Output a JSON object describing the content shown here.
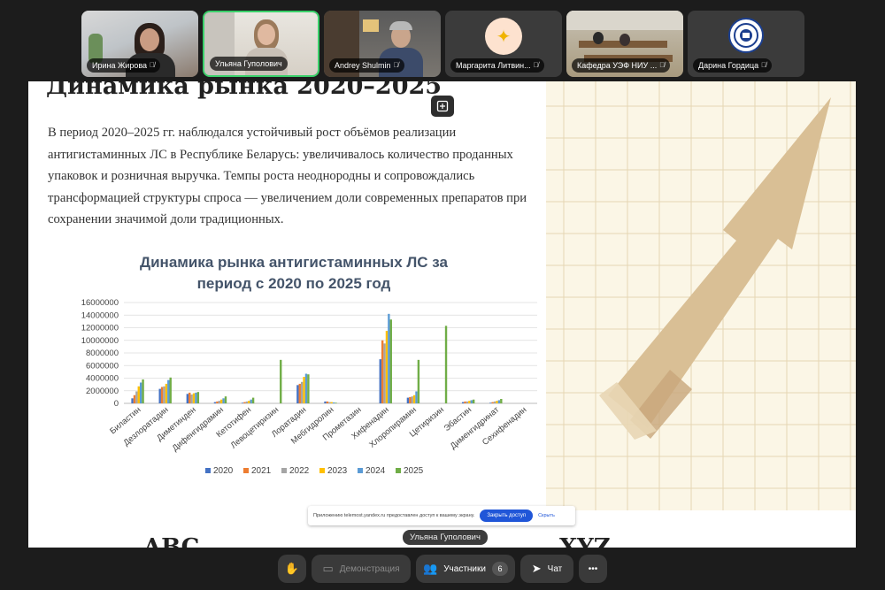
{
  "participants": [
    {
      "name": "Ирина Жирова",
      "muted": true
    },
    {
      "name": "Ульяна Гуполович",
      "muted": false,
      "active": true
    },
    {
      "name": "Andrey Shulmin",
      "muted": true
    },
    {
      "name": "Маргарита Литвин...",
      "muted": true
    },
    {
      "name": "Кафедра УЭФ НИУ ...",
      "muted": true
    },
    {
      "name": "Дарина Гордица",
      "muted": true
    }
  ],
  "slide": {
    "title": "Динамика рынка 2020–2025",
    "paragraph": "В период 2020–2025 гг. наблюдался устойчивый рост объёмов реализации антигистаминных ЛС в Республике Беларусь: увеличивалось количество проданных упаковок и розничная выручка. Темпы роста неоднородны и сопровождались трансформацией структуры спроса — увеличением доли современных препаратов при сохранении значимой доли традиционных.",
    "bottom_left": "ABC",
    "bottom_right": "XYZ"
  },
  "chart_data": {
    "type": "bar",
    "title": "Динамика рынка антигистаминных ЛС за период с 2020 по 2025 год",
    "title_lines": [
      "Динамика рынка антигистаминных ЛС за",
      "период с 2020 по 2025 год"
    ],
    "categories": [
      "Биластин",
      "Дезлоратадин",
      "Диметинден",
      "Дифенгидрамин",
      "Кетотифен",
      "Левоцетиризин",
      "Лоратадин",
      "Мебгидролин",
      "Прометазин",
      "Хифенадин",
      "Хлоропирамин",
      "Цетиризин",
      "Эбастин",
      "Дименгидринат",
      "Сехифенадин"
    ],
    "series": [
      {
        "name": "2020",
        "color": "#4472c4",
        "values": [
          800000,
          2300000,
          1500000,
          200000,
          100000,
          0,
          2900000,
          300000,
          0,
          7000000,
          900000,
          0,
          200000,
          100000,
          0
        ]
      },
      {
        "name": "2021",
        "color": "#ed7d31",
        "values": [
          1300000,
          2600000,
          1700000,
          300000,
          200000,
          0,
          3100000,
          300000,
          0,
          10000000,
          1000000,
          0,
          300000,
          200000,
          0
        ]
      },
      {
        "name": "2022",
        "color": "#a5a5a5",
        "values": [
          1900000,
          2700000,
          1400000,
          400000,
          300000,
          0,
          3400000,
          200000,
          0,
          9500000,
          1100000,
          0,
          300000,
          300000,
          0
        ]
      },
      {
        "name": "2023",
        "color": "#ffc000",
        "values": [
          2700000,
          3100000,
          1600000,
          600000,
          400000,
          0,
          4200000,
          200000,
          0,
          11500000,
          1300000,
          0,
          400000,
          400000,
          0
        ]
      },
      {
        "name": "2024",
        "color": "#5b9bd5",
        "values": [
          3300000,
          3700000,
          1700000,
          800000,
          600000,
          0,
          4700000,
          150000,
          0,
          14200000,
          1900000,
          0,
          500000,
          500000,
          0
        ]
      },
      {
        "name": "2025",
        "color": "#70ad47",
        "values": [
          3800000,
          4100000,
          1800000,
          1100000,
          900000,
          6900000,
          4600000,
          100000,
          0,
          13300000,
          6900000,
          12300000,
          600000,
          700000,
          0
        ]
      }
    ],
    "ylim": [
      0,
      16000000
    ],
    "yticks": [
      0,
      2000000,
      4000000,
      6000000,
      8000000,
      10000000,
      12000000,
      14000000,
      16000000
    ],
    "ytick_labels": [
      "0",
      "2000000",
      "4000000",
      "6000000",
      "8000000",
      "10000000",
      "12000000",
      "14000000",
      "16000000"
    ],
    "grid": true,
    "legend": "bottom"
  },
  "share_notice": {
    "text": "Приложению telemost.yandex.ru предоставлен доступ к вашему экрану.",
    "button": "Закрыть доступ",
    "hide": "Скрыть"
  },
  "speaker_label": "Ульяна Гуполович",
  "controls": {
    "raise_hand_icon": "hand-icon",
    "demo": "Демонстрация",
    "participants": "Участники",
    "participants_count": "6",
    "chat": "Чат",
    "more": "•••"
  },
  "colors": {
    "active_border": "#3ad06a",
    "share_button": "#2056d8",
    "arrow": "#d9bf95"
  }
}
